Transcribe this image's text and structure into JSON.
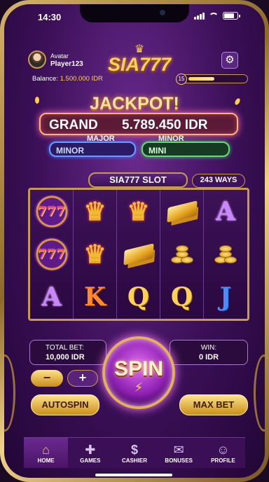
{
  "status": {
    "time": "14:30"
  },
  "user": {
    "avatar_label": "Avatar",
    "name": "Player123"
  },
  "logo": {
    "text": "SIA777"
  },
  "balance": {
    "label": "Balance:",
    "value": "1.500.000 IDR"
  },
  "level": {
    "number": "15",
    "progress_percent": 45
  },
  "jackpot": {
    "title": "JACKPOT!",
    "grand_label": "GRAND",
    "grand_amount": "5.789.450 IDR",
    "major_caption": "MAJOR",
    "minor_label": "MINOR",
    "minor_caption": "MINOR",
    "mini_label": "MINI"
  },
  "slot": {
    "title": "SIA777 SLOT",
    "ways": "243 WAYS"
  },
  "reels": [
    [
      "777",
      "777",
      "A"
    ],
    [
      "crown",
      "crown",
      "K"
    ],
    [
      "crown",
      "gold-bars",
      "Q"
    ],
    [
      "gold-bars",
      "gold-coins",
      "Q"
    ],
    [
      "A",
      "gold-coins",
      "J"
    ]
  ],
  "bet": {
    "label": "TOTAL BET:",
    "value": "10,000 IDR",
    "minus": "−",
    "plus": "+"
  },
  "win": {
    "label": "WIN:",
    "value": "0 IDR"
  },
  "controls": {
    "spin": "SPIN",
    "autospin": "AUTOSPIN",
    "max_bet": "MAX BET"
  },
  "nav": [
    {
      "label": "HOME",
      "icon": "home-icon"
    },
    {
      "label": "GAMES",
      "icon": "gamepad-icon"
    },
    {
      "label": "CASHIER",
      "icon": "dollar-icon"
    },
    {
      "label": "BONUSES",
      "icon": "gift-icon"
    },
    {
      "label": "PROFILE",
      "icon": "user-icon"
    }
  ],
  "colors": {
    "accent_gold": "#ffd257",
    "bg_purple": "#3a0f56",
    "grand_border": "#ffb46b",
    "minor_border": "#6a9cff",
    "mini_border": "#6bd877"
  }
}
